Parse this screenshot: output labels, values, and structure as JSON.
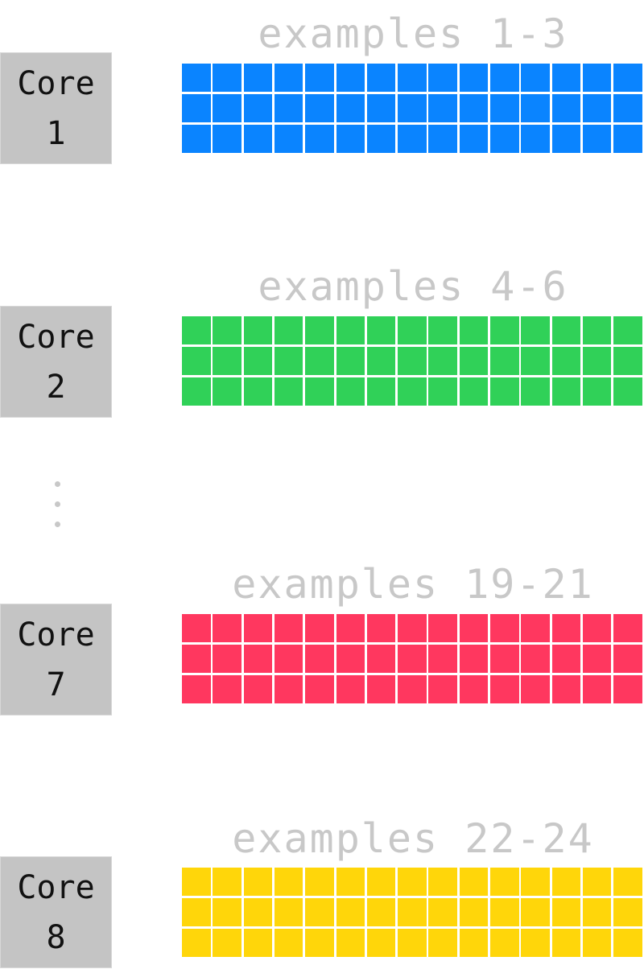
{
  "groups": [
    {
      "core_word": "Core",
      "core_number": "1",
      "label": "examples 1-3",
      "color": "#0a84ff"
    },
    {
      "core_word": "Core",
      "core_number": "2",
      "label": "examples 4-6",
      "color": "#30d158"
    },
    {
      "core_word": "Core",
      "core_number": "7",
      "label": "examples 19-21",
      "color": "#ff375f"
    },
    {
      "core_word": "Core",
      "core_number": "8",
      "label": "examples 22-24",
      "color": "#ffd60a"
    }
  ],
  "grid": {
    "rows": 3,
    "columns": 15
  },
  "ellipsis": {
    "icon": "vertical-ellipsis-icon",
    "dot_color": "#c8c8c8"
  }
}
